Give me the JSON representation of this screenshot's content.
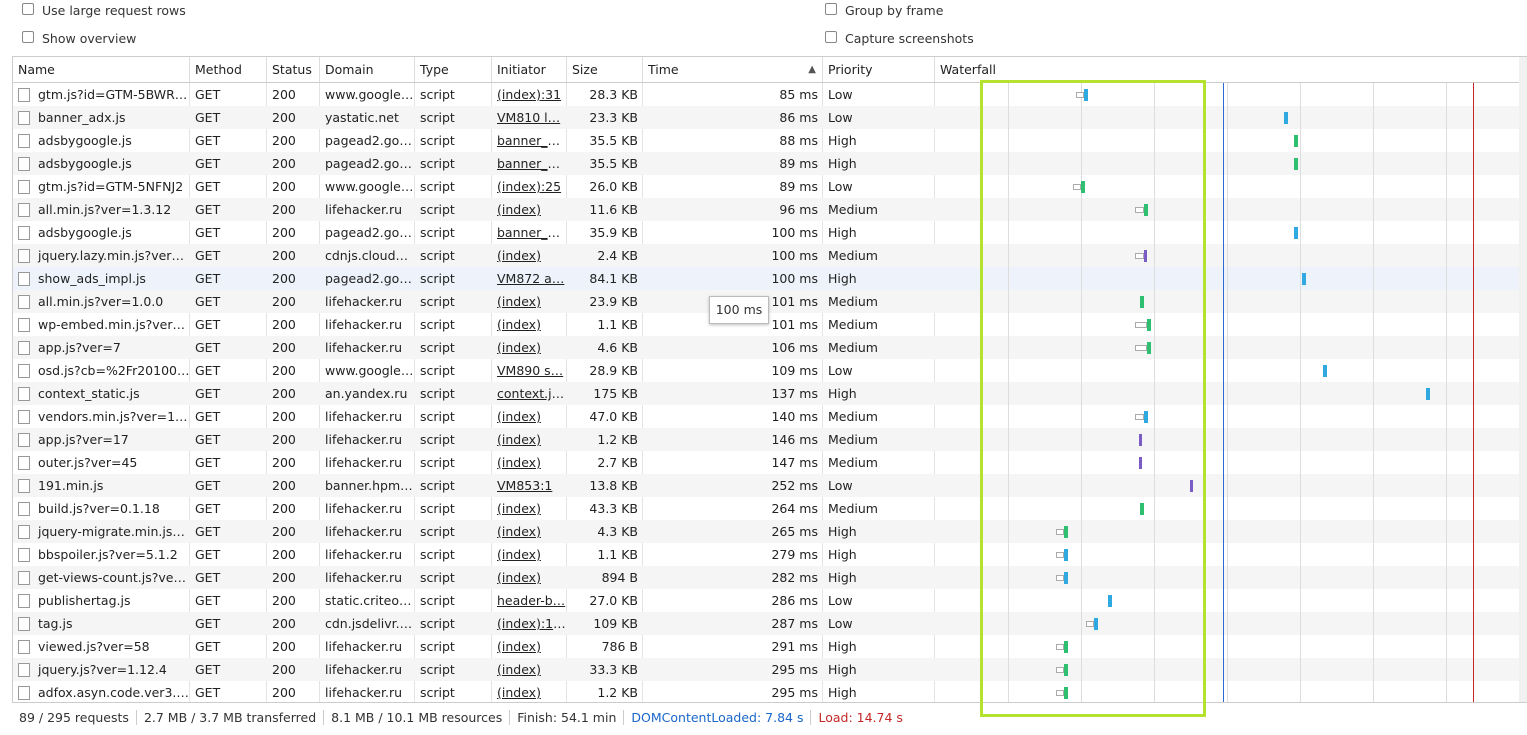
{
  "options": {
    "large_rows": "Use large request rows",
    "show_overview": "Show overview",
    "group_by_frame": "Group by frame",
    "capture_screenshots": "Capture screenshots"
  },
  "columns": {
    "name": "Name",
    "method": "Method",
    "status": "Status",
    "domain": "Domain",
    "type": "Type",
    "initiator": "Initiator",
    "size": "Size",
    "time": "Time",
    "priority": "Priority",
    "waterfall": "Waterfall",
    "sort_indicator": "▲"
  },
  "tooltip": "100 ms",
  "colors": {
    "highlight_box": "#b5e22e",
    "dom_content_loaded": "#1a66c9",
    "load": "#c62828",
    "bar_blue": "#2fa9e0",
    "bar_green": "#2fbf71",
    "bar_purple": "#7b5cc7",
    "bar_red": "#c8454c"
  },
  "rows": [
    {
      "name": "gtm.js?id=GTM-5BWR…",
      "method": "GET",
      "status": "200",
      "domain": "www.google…",
      "type": "script",
      "initiator": "(index):31",
      "size": "28.3 KB",
      "time": "85 ms",
      "priority": "Low",
      "bar": "blue"
    },
    {
      "name": "banner_adx.js",
      "method": "GET",
      "status": "200",
      "domain": "yastatic.net",
      "type": "script",
      "initiator": "VM810 l…",
      "size": "23.3 KB",
      "time": "86 ms",
      "priority": "Low",
      "bar": "blue"
    },
    {
      "name": "adsbygoogle.js",
      "method": "GET",
      "status": "200",
      "domain": "pagead2.go…",
      "type": "script",
      "initiator": "banner_a…",
      "size": "35.5 KB",
      "time": "88 ms",
      "priority": "High",
      "bar": "green"
    },
    {
      "name": "adsbygoogle.js",
      "method": "GET",
      "status": "200",
      "domain": "pagead2.go…",
      "type": "script",
      "initiator": "banner_a…",
      "size": "35.5 KB",
      "time": "89 ms",
      "priority": "High",
      "bar": "green"
    },
    {
      "name": "gtm.js?id=GTM-5NFNJ2",
      "method": "GET",
      "status": "200",
      "domain": "www.google…",
      "type": "script",
      "initiator": "(index):25",
      "size": "26.0 KB",
      "time": "89 ms",
      "priority": "Low",
      "bar": "green"
    },
    {
      "name": "all.min.js?ver=1.3.12",
      "method": "GET",
      "status": "200",
      "domain": "lifehacker.ru",
      "type": "script",
      "initiator": "(index)",
      "size": "11.6 KB",
      "time": "96 ms",
      "priority": "Medium",
      "bar": "green"
    },
    {
      "name": "adsbygoogle.js",
      "method": "GET",
      "status": "200",
      "domain": "pagead2.go…",
      "type": "script",
      "initiator": "banner_a…",
      "size": "35.9 KB",
      "time": "100 ms",
      "priority": "High",
      "bar": "blue"
    },
    {
      "name": "jquery.lazy.min.js?ver=…",
      "method": "GET",
      "status": "200",
      "domain": "cdnjs.cloudfl…",
      "type": "script",
      "initiator": "(index)",
      "size": "2.4 KB",
      "time": "100 ms",
      "priority": "Medium",
      "bar": "purple"
    },
    {
      "name": "show_ads_impl.js",
      "method": "GET",
      "status": "200",
      "domain": "pagead2.go…",
      "type": "script",
      "initiator": "VM872 a…",
      "size": "84.1 KB",
      "time": "100 ms",
      "priority": "High",
      "bar": "blue"
    },
    {
      "name": "all.min.js?ver=1.0.0",
      "method": "GET",
      "status": "200",
      "domain": "lifehacker.ru",
      "type": "script",
      "initiator": "(index)",
      "size": "23.9 KB",
      "time": "101 ms",
      "priority": "Medium",
      "bar": "green"
    },
    {
      "name": "wp-embed.min.js?ver=…",
      "method": "GET",
      "status": "200",
      "domain": "lifehacker.ru",
      "type": "script",
      "initiator": "(index)",
      "size": "1.1 KB",
      "time": "101 ms",
      "priority": "Medium",
      "bar": "green"
    },
    {
      "name": "app.js?ver=7",
      "method": "GET",
      "status": "200",
      "domain": "lifehacker.ru",
      "type": "script",
      "initiator": "(index)",
      "size": "4.6 KB",
      "time": "106 ms",
      "priority": "Medium",
      "bar": "green"
    },
    {
      "name": "osd.js?cb=%2Fr201001…",
      "method": "GET",
      "status": "200",
      "domain": "www.google…",
      "type": "script",
      "initiator": "VM890 s…",
      "size": "28.9 KB",
      "time": "109 ms",
      "priority": "Low",
      "bar": "blue"
    },
    {
      "name": "context_static.js",
      "method": "GET",
      "status": "200",
      "domain": "an.yandex.ru",
      "type": "script",
      "initiator": "context.js:1",
      "size": "175 KB",
      "time": "137 ms",
      "priority": "High",
      "bar": "blue"
    },
    {
      "name": "vendors.min.js?ver=1.3…",
      "method": "GET",
      "status": "200",
      "domain": "lifehacker.ru",
      "type": "script",
      "initiator": "(index)",
      "size": "47.0 KB",
      "time": "140 ms",
      "priority": "Medium",
      "bar": "blue"
    },
    {
      "name": "app.js?ver=17",
      "method": "GET",
      "status": "200",
      "domain": "lifehacker.ru",
      "type": "script",
      "initiator": "(index)",
      "size": "1.2 KB",
      "time": "146 ms",
      "priority": "Medium",
      "bar": "purple"
    },
    {
      "name": "outer.js?ver=45",
      "method": "GET",
      "status": "200",
      "domain": "lifehacker.ru",
      "type": "script",
      "initiator": "(index)",
      "size": "2.7 KB",
      "time": "147 ms",
      "priority": "Medium",
      "bar": "purple"
    },
    {
      "name": "191.min.js",
      "method": "GET",
      "status": "200",
      "domain": "banner.hpm…",
      "type": "script",
      "initiator": "VM853:1",
      "size": "13.8 KB",
      "time": "252 ms",
      "priority": "Low",
      "bar": "purple"
    },
    {
      "name": "build.js?ver=0.1.18",
      "method": "GET",
      "status": "200",
      "domain": "lifehacker.ru",
      "type": "script",
      "initiator": "(index)",
      "size": "43.3 KB",
      "time": "264 ms",
      "priority": "Medium",
      "bar": "green"
    },
    {
      "name": "jquery-migrate.min.js?v…",
      "method": "GET",
      "status": "200",
      "domain": "lifehacker.ru",
      "type": "script",
      "initiator": "(index)",
      "size": "4.3 KB",
      "time": "265 ms",
      "priority": "High",
      "bar": "green"
    },
    {
      "name": "bbspoiler.js?ver=5.1.2",
      "method": "GET",
      "status": "200",
      "domain": "lifehacker.ru",
      "type": "script",
      "initiator": "(index)",
      "size": "1.1 KB",
      "time": "279 ms",
      "priority": "High",
      "bar": "blue"
    },
    {
      "name": "get-views-count.js?ver…",
      "method": "GET",
      "status": "200",
      "domain": "lifehacker.ru",
      "type": "script",
      "initiator": "(index)",
      "size": "894 B",
      "time": "282 ms",
      "priority": "High",
      "bar": "blue"
    },
    {
      "name": "publishertag.js",
      "method": "GET",
      "status": "200",
      "domain": "static.criteo…",
      "type": "script",
      "initiator": "header-b…",
      "size": "27.0 KB",
      "time": "286 ms",
      "priority": "Low",
      "bar": "blue"
    },
    {
      "name": "tag.js",
      "method": "GET",
      "status": "200",
      "domain": "cdn.jsdelivr.n…",
      "type": "script",
      "initiator": "(index):144",
      "size": "109 KB",
      "time": "287 ms",
      "priority": "Low",
      "bar": "blue"
    },
    {
      "name": "viewed.js?ver=58",
      "method": "GET",
      "status": "200",
      "domain": "lifehacker.ru",
      "type": "script",
      "initiator": "(index)",
      "size": "786 B",
      "time": "291 ms",
      "priority": "High",
      "bar": "green"
    },
    {
      "name": "jquery.js?ver=1.12.4",
      "method": "GET",
      "status": "200",
      "domain": "lifehacker.ru",
      "type": "script",
      "initiator": "(index)",
      "size": "33.3 KB",
      "time": "295 ms",
      "priority": "High",
      "bar": "green"
    },
    {
      "name": "adfox.asyn.code.ver3.js…",
      "method": "GET",
      "status": "200",
      "domain": "lifehacker.ru",
      "type": "script",
      "initiator": "(index)",
      "size": "1.2 KB",
      "time": "295 ms",
      "priority": "High",
      "bar": "green"
    }
  ],
  "footer": {
    "requests": "89 / 295 requests",
    "transferred": "2.7 MB / 3.7 MB transferred",
    "resources": "8.1 MB / 10.1 MB resources",
    "finish": "Finish: 54.1 min",
    "dom_content_loaded": "DOMContentLoaded: 7.84 s",
    "load": "Load: 14.74 s"
  }
}
